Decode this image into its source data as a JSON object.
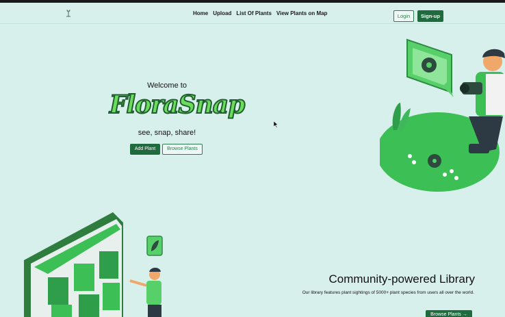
{
  "nav": {
    "links": [
      "Home",
      "Upload",
      "List Of Plants",
      "View Plants on Map"
    ],
    "login": "Login",
    "signup": "Sign-up"
  },
  "hero": {
    "welcome": "Welcome to",
    "brand": "FloraSnap",
    "tagline": "see, snap, share!",
    "add_plant": "Add Plant",
    "browse_plants": "Browse Plants"
  },
  "section": {
    "title": "Community-powered Library",
    "description": "Our library features plant sightings of 5000+ plant species from users all over the world.",
    "button": "Browse Plants →"
  },
  "colors": {
    "background": "#d8f0ec",
    "primary": "#1f6b3e",
    "accent": "#3cbf55"
  }
}
